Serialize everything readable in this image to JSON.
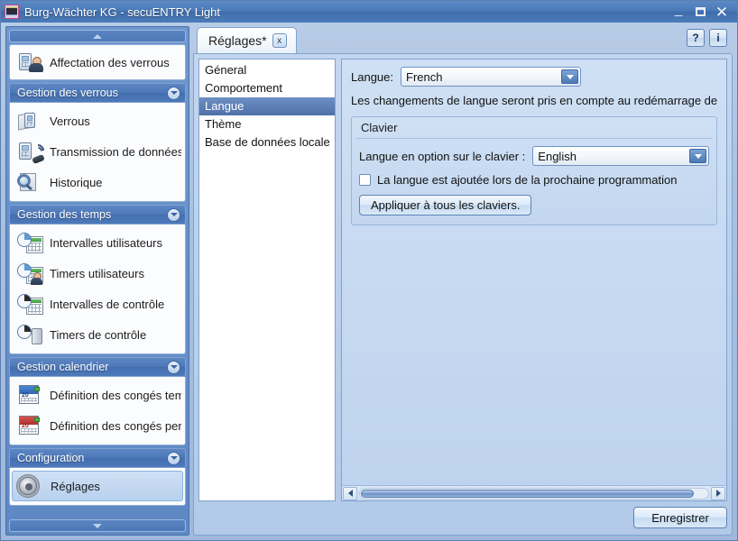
{
  "window": {
    "title": "Burg-Wächter KG - secuENTRY Light",
    "app_icon": "app-icon",
    "minimize_label": "_",
    "maximize_label": "□",
    "close_label": "✕"
  },
  "help_buttons": [
    {
      "name": "help-button",
      "label": "?"
    },
    {
      "name": "info-button",
      "label": "i"
    }
  ],
  "sidebar": {
    "scroll_up": "▲",
    "scroll_down": "▼",
    "top_items": [
      {
        "label": "Affectation des verrous",
        "icon": "lock-assignment-icon"
      }
    ],
    "groups": [
      {
        "header": "Gestion des verrous",
        "collapse_icon": "chevron-down-icon",
        "items": [
          {
            "label": "Verrous",
            "icon": "lock-icon"
          },
          {
            "label": "Transmission de données",
            "icon": "data-transfer-icon"
          },
          {
            "label": "Historique",
            "icon": "history-icon"
          }
        ]
      },
      {
        "header": "Gestion des temps",
        "collapse_icon": "chevron-down-icon",
        "items": [
          {
            "label": "Intervalles utilisateurs",
            "icon": "user-intervals-icon"
          },
          {
            "label": "Timers utilisateurs",
            "icon": "user-timers-icon"
          },
          {
            "label": "Intervalles de contrôle",
            "icon": "control-intervals-icon"
          },
          {
            "label": "Timers de contrôle",
            "icon": "control-timers-icon"
          }
        ]
      },
      {
        "header": "Gestion calendrier",
        "collapse_icon": "chevron-down-icon",
        "items": [
          {
            "label": "Définition des congés tempo",
            "icon": "calendar-temporary-icon"
          },
          {
            "label": "Définition des congés perma",
            "icon": "calendar-permanent-icon"
          }
        ]
      },
      {
        "header": "Configuration",
        "collapse_icon": "chevron-down-icon",
        "items": [
          {
            "label": "Réglages",
            "icon": "gear-icon",
            "selected": true
          }
        ]
      }
    ]
  },
  "tab": {
    "label": "Réglages*",
    "close_label": "x"
  },
  "categories": [
    {
      "label": "Géneral",
      "selected": false
    },
    {
      "label": "Comportement",
      "selected": false
    },
    {
      "label": "Langue",
      "selected": true
    },
    {
      "label": "Thème",
      "selected": false
    },
    {
      "label": "Base de données locale",
      "selected": false
    }
  ],
  "settings": {
    "language_label": "Langue:",
    "language_value": "French",
    "restart_hint": "Les changements de langue seront pris en compte au redémarrage de l'applicati",
    "keyboard_group": {
      "title": "Clavier",
      "option_label": "Langue en option sur le clavier :",
      "option_value": "English",
      "checkbox_label": "La langue est ajoutée lors de la prochaine programmation",
      "checkbox_checked": false,
      "apply_button": "Appliquer à tous les claviers."
    }
  },
  "footer": {
    "save_label": "Enregistrer"
  },
  "scrollbar": {
    "left_arrow": "◄",
    "right_arrow": "►"
  },
  "colors": {
    "title_bar": "#4a7ab8",
    "accent": "#4f71a8",
    "panel_bg": "#bed3ee",
    "sidebar_bg": "#5e88c4",
    "selection": "#4f71a8"
  }
}
